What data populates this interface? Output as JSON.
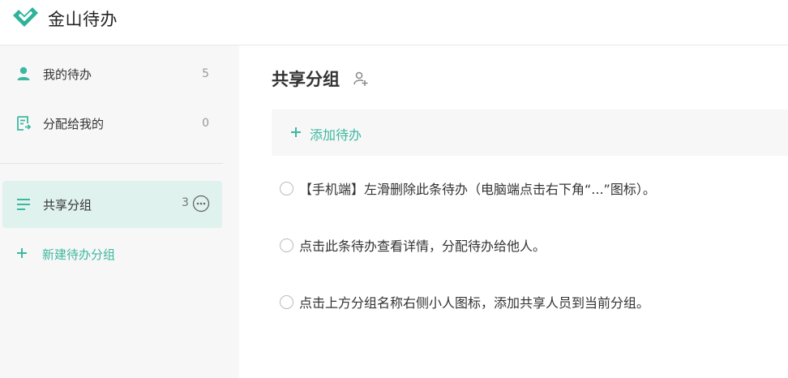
{
  "app": {
    "title": "金山待办"
  },
  "colors": {
    "accent": "#3db8a0",
    "sidebar_bg": "#f7f7f7",
    "selected_bg": "#dff2ee"
  },
  "sidebar": {
    "items": [
      {
        "icon": "person-icon",
        "label": "我的待办",
        "count": "5"
      },
      {
        "icon": "assigned-icon",
        "label": "分配给我的",
        "count": "0"
      }
    ],
    "groups": [
      {
        "icon": "list-icon",
        "label": "共享分组",
        "count": "3"
      }
    ],
    "new_group_label": "新建待办分组"
  },
  "main": {
    "title": "共享分组",
    "add_todo_label": "添加待办",
    "todos": [
      "【手机端】左滑删除此条待办（电脑端点击右下角“...”图标）。",
      "点击此条待办查看详情，分配待办给他人。",
      "点击上方分组名称右侧小人图标，添加共享人员到当前分组。"
    ]
  }
}
